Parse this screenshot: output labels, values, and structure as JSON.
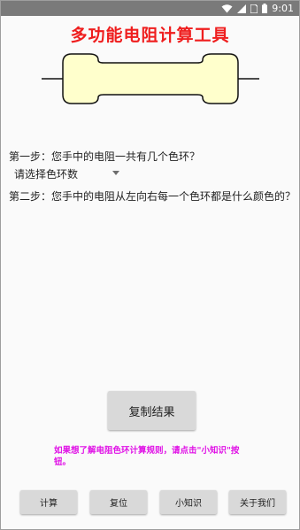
{
  "status_bar": {
    "time": "9:01",
    "icons": [
      "wifi-icon",
      "signal-icon",
      "sim-card-icon",
      "battery-icon"
    ]
  },
  "app": {
    "title": "多功能电阻计算工具",
    "title_color": "#ef1e1e"
  },
  "resistor": {
    "body_color": "#ffffcc",
    "outline_color": "#111111"
  },
  "step1": {
    "label": "第一步：您手中的电阻一共有几个色环？",
    "select_value": "请选择色环数"
  },
  "step2": {
    "label": "第二步：您手中的电阻从左向右每一个色环都是什么颜色的？"
  },
  "copy_button": {
    "label": "复制结果"
  },
  "hint": {
    "text": "如果想了解电阻色环计算规则，请点击\"小知识\"按钮。",
    "color": "#e012e6"
  },
  "bottom_buttons": [
    {
      "label": "计算"
    },
    {
      "label": "复位"
    },
    {
      "label": "小知识"
    },
    {
      "label": "关于我们"
    }
  ]
}
